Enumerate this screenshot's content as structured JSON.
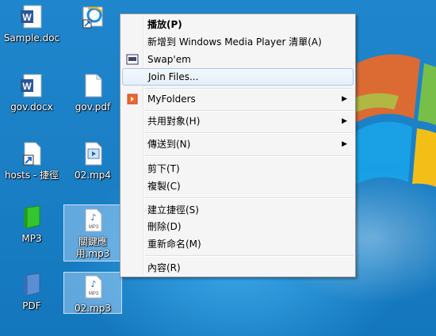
{
  "desktop": {
    "icons": [
      {
        "label": "Sample.doc"
      },
      {
        "label": ""
      },
      {
        "label": "gov.docx"
      },
      {
        "label": "gov.pdf"
      },
      {
        "label": "hosts - 捷徑"
      },
      {
        "label": "02.mp4"
      },
      {
        "label": "MP3"
      },
      {
        "label": "關鍵應用.mp3"
      },
      {
        "label": "PDF"
      },
      {
        "label": "02.mp3"
      }
    ]
  },
  "context_menu": {
    "items": [
      {
        "label": "播放(P)"
      },
      {
        "label": "新增到 Windows Media Player 清單(A)"
      },
      {
        "label": "Swap'em"
      },
      {
        "label": "Join Files..."
      },
      {
        "label": "MyFolders"
      },
      {
        "label": "共用對象(H)"
      },
      {
        "label": "傳送到(N)"
      },
      {
        "label": "剪下(T)"
      },
      {
        "label": "複製(C)"
      },
      {
        "label": "建立捷徑(S)"
      },
      {
        "label": "刪除(D)"
      },
      {
        "label": "重新命名(M)"
      },
      {
        "label": "內容(R)"
      }
    ]
  },
  "colors": {
    "desktop_blue": "#1b80c6",
    "menu_bg": "#f5f5f5",
    "menu_hover_border": "#a8c8eb"
  }
}
